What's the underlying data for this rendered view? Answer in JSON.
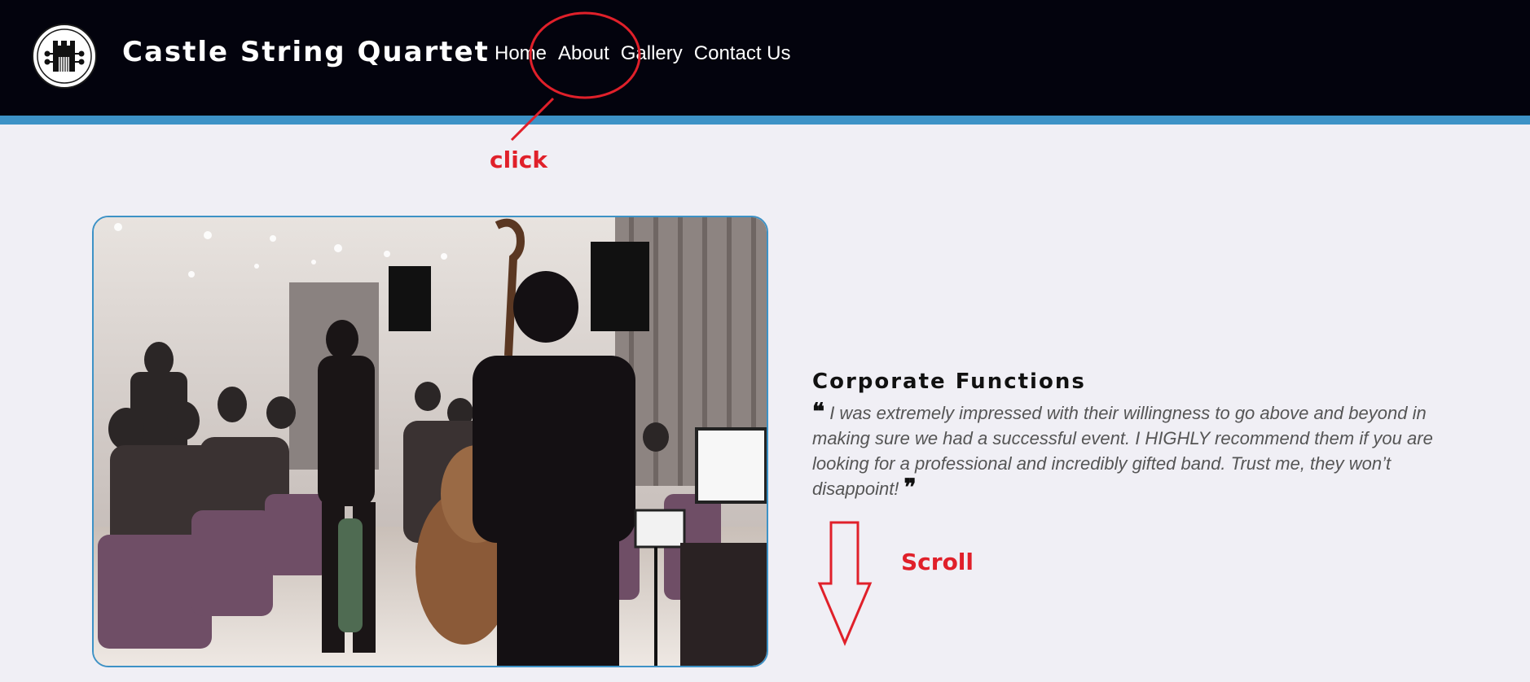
{
  "header": {
    "brand": "Castle String Quartet",
    "logo_icon": "castle-guitar-logo-icon",
    "background": "#03030d",
    "accent": "#3d92c6"
  },
  "nav": {
    "items": [
      {
        "label": "Home"
      },
      {
        "label": "About"
      },
      {
        "label": "Gallery"
      },
      {
        "label": "Contact Us"
      }
    ]
  },
  "annotations": {
    "click_label": "click",
    "scroll_label": "Scroll",
    "color": "#e0202a"
  },
  "hero": {
    "image_subject": "string-quartet-performing-at-banquet-photo"
  },
  "testimonial": {
    "title": "Corporate Functions",
    "quote": "I was extremely impressed with their willingness to go above and beyond in making sure we had a successful event. I HIGHLY recommend them if you are looking for a professional and incredibly gifted band. Trust me, they won’t disappoint!",
    "open_mark": "❝",
    "close_mark": "❞"
  }
}
